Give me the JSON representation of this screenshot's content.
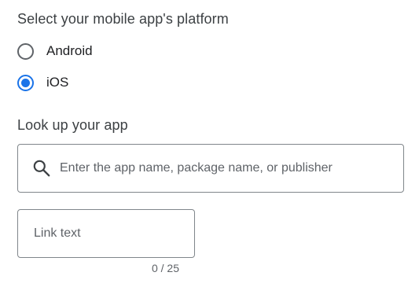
{
  "platform": {
    "title": "Select your mobile app's platform",
    "options": [
      {
        "label": "Android",
        "selected": false
      },
      {
        "label": "iOS",
        "selected": true
      }
    ]
  },
  "lookup": {
    "title": "Look up your app",
    "search_icon": "search-icon",
    "search_placeholder": "Enter the app name, package name, or publisher",
    "search_value": ""
  },
  "link_text": {
    "placeholder": "Link text",
    "value": "",
    "counter": "0 / 25"
  },
  "colors": {
    "accent": "#1a73e8",
    "text": "#3c4043",
    "border": "#80868b"
  }
}
